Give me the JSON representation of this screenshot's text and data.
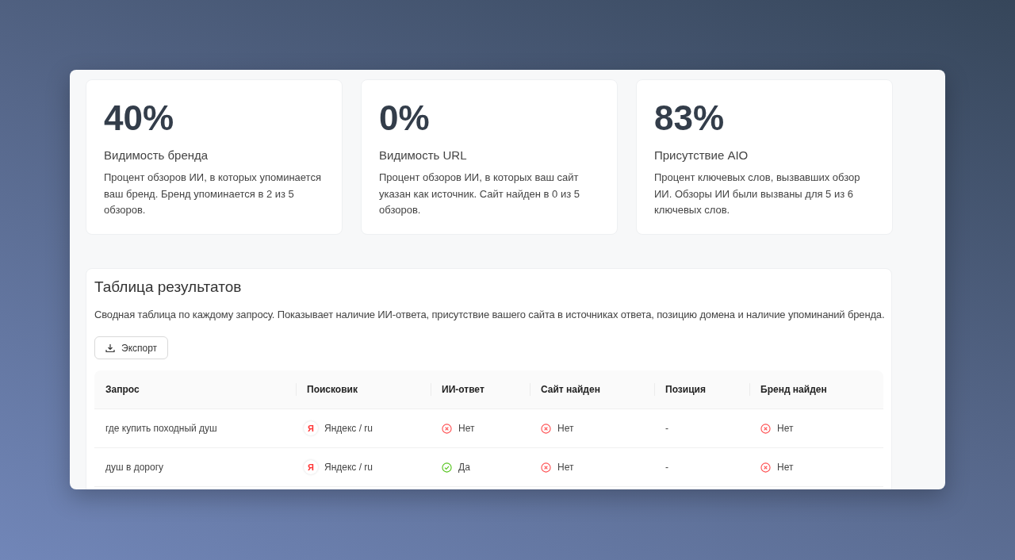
{
  "metrics": [
    {
      "value": "40%",
      "label": "Видимость бренда",
      "description": "Процент обзоров ИИ, в которых упоминается ваш бренд. Бренд упоминается в 2 из 5 обзоров."
    },
    {
      "value": "0%",
      "label": "Видимость URL",
      "description": "Процент обзоров ИИ, в которых ваш сайт указан как источник. Сайт найден в 0 из 5 обзоров."
    },
    {
      "value": "83%",
      "label": "Присутствие AIO",
      "description": "Процент ключевых слов, вызвавших обзор ИИ. Обзоры ИИ были вызваны для 5 из 6 ключевых слов."
    }
  ],
  "results": {
    "title": "Таблица результатов",
    "description": "Сводная таблица по каждому запросу. Показывает наличие ИИ-ответа, присутствие вашего сайта в источниках ответа, позицию домена и наличие упоминаний бренда.",
    "export_button": "Экспорт",
    "columns": [
      "Запрос",
      "Поисковик",
      "ИИ-ответ",
      "Сайт найден",
      "Позиция",
      "Бренд найден"
    ],
    "rows": [
      {
        "query": "где купить походный душ",
        "engine": {
          "badge": "Я",
          "label": "Яндекс / ru"
        },
        "ai_answer": {
          "ok": false,
          "text": "Нет"
        },
        "site_found": {
          "ok": false,
          "text": "Нет"
        },
        "position": "-",
        "brand_found": {
          "ok": false,
          "text": "Нет"
        }
      },
      {
        "query": "душ в дорогу",
        "engine": {
          "badge": "Я",
          "label": "Яндекс / ru"
        },
        "ai_answer": {
          "ok": true,
          "text": "Да"
        },
        "site_found": {
          "ok": false,
          "text": "Нет"
        },
        "position": "-",
        "brand_found": {
          "ok": false,
          "text": "Нет"
        }
      }
    ]
  }
}
